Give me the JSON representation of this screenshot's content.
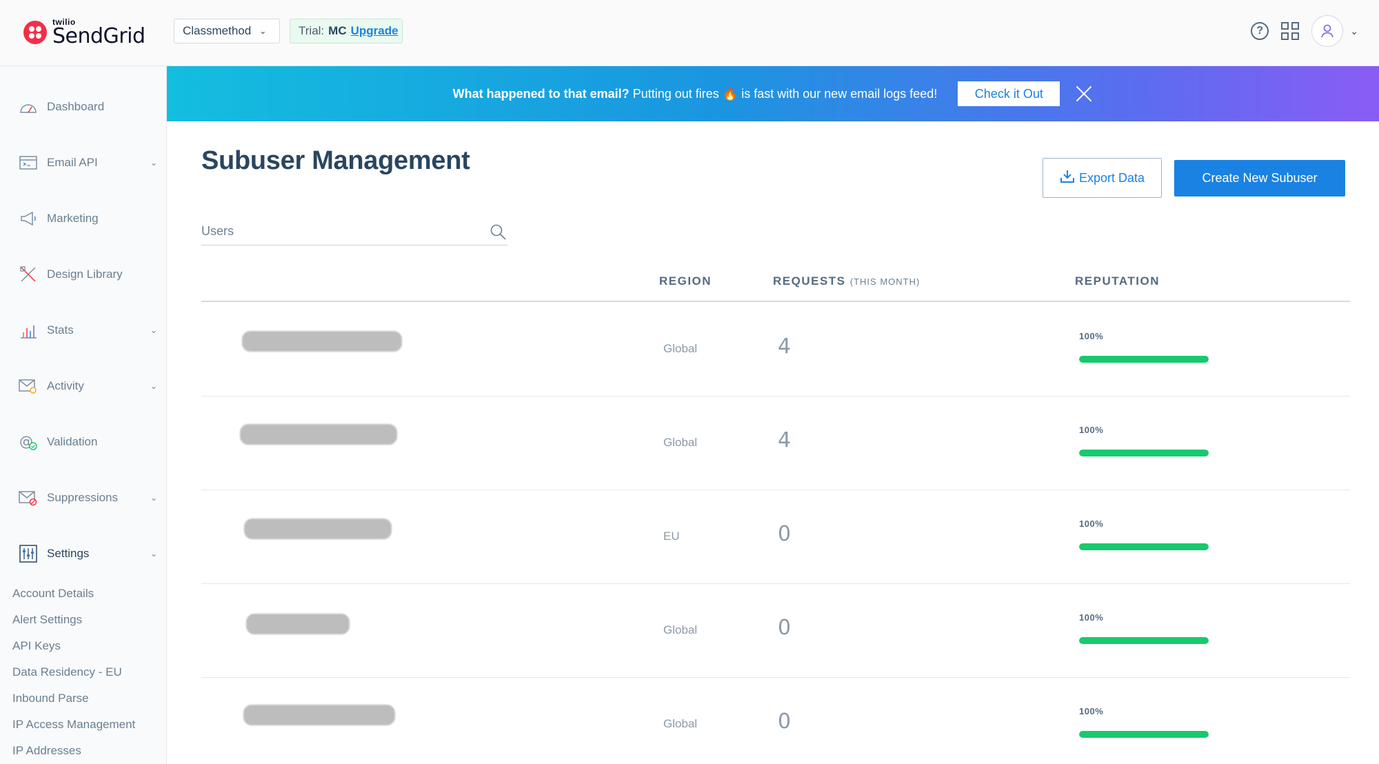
{
  "header": {
    "logo_small": "twilio",
    "logo_big": "SendGrid",
    "account": "Classmethod",
    "trial_label": "Trial:",
    "trial_plan": "MC",
    "trial_upgrade": "Upgrade"
  },
  "banner": {
    "bold": "What happened to that email?",
    "text_before_fire": " Putting out fires ",
    "fire": "🔥",
    "text_after_fire": " is fast with our new email logs feed!",
    "button": "Check it Out"
  },
  "sidebar": {
    "items": [
      {
        "label": "Dashboard",
        "icon": "gauge-icon",
        "chevron": false
      },
      {
        "label": "Email API",
        "icon": "code-window-icon",
        "chevron": true
      },
      {
        "label": "Marketing",
        "icon": "megaphone-icon",
        "chevron": false
      },
      {
        "label": "Design Library",
        "icon": "design-tools-icon",
        "chevron": false
      },
      {
        "label": "Stats",
        "icon": "bar-chart-icon",
        "chevron": true
      },
      {
        "label": "Activity",
        "icon": "envelope-search-icon",
        "chevron": true
      },
      {
        "label": "Validation",
        "icon": "at-check-icon",
        "chevron": false
      },
      {
        "label": "Suppressions",
        "icon": "envelope-block-icon",
        "chevron": true
      },
      {
        "label": "Settings",
        "icon": "sliders-icon",
        "chevron": true
      }
    ],
    "settings_sub": [
      "Account Details",
      "Alert Settings",
      "API Keys",
      "Data Residency - EU",
      "Inbound Parse",
      "IP Access Management",
      "IP Addresses"
    ]
  },
  "main": {
    "title": "Subuser Management",
    "export_label": "Export Data",
    "create_label": "Create New Subuser",
    "search_placeholder": "Users",
    "columns": {
      "region": "REGION",
      "requests": "REQUESTS",
      "requests_sub": "(THIS MONTH)",
      "reputation": "REPUTATION"
    },
    "rows": [
      {
        "region": "Global",
        "requests": "4",
        "reputation_label": "100%",
        "reputation": 100
      },
      {
        "region": "Global",
        "requests": "4",
        "reputation_label": "100%",
        "reputation": 100
      },
      {
        "region": "EU",
        "requests": "0",
        "reputation_label": "100%",
        "reputation": 100
      },
      {
        "region": "Global",
        "requests": "0",
        "reputation_label": "100%",
        "reputation": 100
      },
      {
        "region": "Global",
        "requests": "0",
        "reputation_label": "100%",
        "reputation": 100
      }
    ]
  },
  "colors": {
    "primary": "#1a82e2",
    "text": "#294661",
    "reputation_good": "#18c96e",
    "brand_red": "#f22f46"
  }
}
